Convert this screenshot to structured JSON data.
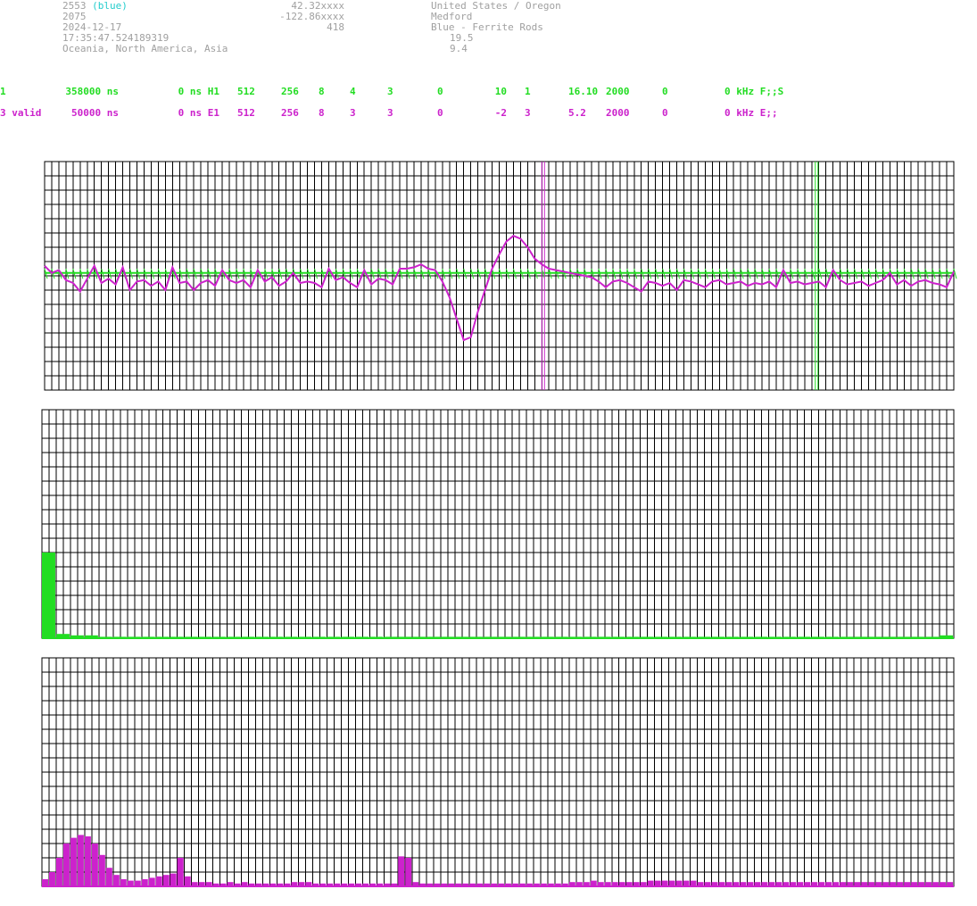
{
  "header": {
    "station_id": "2553",
    "station_color": "(blue)",
    "station_number": "2075",
    "date": "2024-12-17",
    "time": "17:35:47.524189319",
    "regions": "Oceania, North America, Asia",
    "latitude": "42.32xxxx",
    "longitude": "-122.86xxxx",
    "altitude": "418",
    "country": "United States / Oregon",
    "city": "Medford",
    "antenna": "Blue - Ferrite Rods",
    "value_a": "19.5",
    "value_b": "9.4"
  },
  "channels": [
    {
      "c0": "1",
      "c1": "358000 ns",
      "c2": "0 ns H1",
      "c3": "512",
      "c4": "256",
      "c5": "8",
      "c6": "4",
      "c7": "3",
      "c8": "0",
      "c9": "10",
      "c10": "1",
      "c11": "16.10",
      "c12": "2000",
      "c13": "0",
      "c14": "0 kHz F;;S"
    },
    {
      "c0": "3 valid",
      "c1": "50000 ns",
      "c2": "0 ns E1",
      "c3": "512",
      "c4": "256",
      "c5": "8",
      "c6": "3",
      "c7": "3",
      "c8": "0",
      "c9": "-2",
      "c10": "3",
      "c11": "5.2",
      "c12": "2000",
      "c13": "0",
      "c14": "0 kHz E;;"
    }
  ],
  "colors": {
    "green": "#22dd22",
    "magenta": "#cc22cc",
    "gray_text": "#a0a0a0",
    "grid": "#000000"
  },
  "chart_data": [
    {
      "type": "line",
      "panel": "waveform",
      "title": "",
      "xlabel": "",
      "ylabel": "",
      "ylim": [
        -8,
        8
      ],
      "xlim": [
        0,
        256
      ],
      "markers": [
        {
          "x": 140,
          "color": "magenta"
        },
        {
          "x": 217,
          "color": "green"
        }
      ],
      "series": [
        {
          "color": "magenta",
          "x": [
            0,
            2,
            4,
            6,
            8,
            10,
            12,
            14,
            16,
            18,
            20,
            22,
            24,
            26,
            28,
            30,
            32,
            34,
            36,
            38,
            40,
            42,
            44,
            46,
            48,
            50,
            52,
            54,
            56,
            58,
            60,
            62,
            64,
            66,
            68,
            70,
            72,
            74,
            76,
            78,
            80,
            82,
            84,
            86,
            88,
            90,
            92,
            94,
            96,
            98,
            100,
            102,
            104,
            106,
            108,
            110,
            112,
            114,
            116,
            118,
            120,
            122,
            124,
            126,
            128,
            130,
            132,
            134,
            136,
            138,
            140,
            142,
            144,
            146,
            148,
            150,
            152,
            154,
            156,
            158,
            160,
            162,
            164,
            166,
            168,
            170,
            172,
            174,
            176,
            178,
            180,
            182,
            184,
            186,
            188,
            190,
            192,
            194,
            196,
            198,
            200,
            202,
            204,
            206,
            208,
            210,
            212,
            214,
            216,
            218,
            220,
            222,
            224,
            226,
            228,
            230,
            232,
            234,
            236,
            238,
            240,
            242,
            244,
            246,
            248,
            250,
            252,
            254,
            256
          ],
          "values": [
            0.7,
            0.2,
            0.4,
            -0.3,
            -0.5,
            -1.1,
            -0.2,
            0.7,
            -0.5,
            -0.2,
            -0.6,
            0.6,
            -1.0,
            -0.4,
            -0.3,
            -0.7,
            -0.4,
            -1.0,
            0.6,
            -0.5,
            -0.4,
            -1.0,
            -0.5,
            -0.3,
            -0.7,
            0.4,
            -0.3,
            -0.5,
            -0.3,
            -0.8,
            0.4,
            -0.4,
            -0.1,
            -0.7,
            -0.4,
            0.2,
            -0.5,
            -0.4,
            -0.5,
            -0.8,
            0.5,
            -0.3,
            -0.1,
            -0.5,
            -0.8,
            0.4,
            -0.6,
            -0.2,
            -0.3,
            -0.6,
            0.5,
            0.5,
            0.6,
            0.8,
            0.5,
            0.4,
            -0.4,
            -1.5,
            -3.0,
            -4.5,
            -4.3,
            -2.5,
            -1.0,
            0.5,
            1.5,
            2.4,
            2.8,
            2.6,
            2.0,
            1.2,
            0.8,
            0.5,
            0.4,
            0.3,
            0.2,
            0.1,
            0.0,
            -0.1,
            -0.4,
            -0.8,
            -0.4,
            -0.3,
            -0.5,
            -0.8,
            -1.1,
            -0.4,
            -0.5,
            -0.7,
            -0.5,
            -1.0,
            -0.3,
            -0.4,
            -0.6,
            -0.8,
            -0.4,
            -0.3,
            -0.6,
            -0.5,
            -0.4,
            -0.7,
            -0.5,
            -0.6,
            -0.4,
            -0.8,
            0.4,
            -0.5,
            -0.4,
            -0.6,
            -0.5,
            -0.4,
            -0.8,
            0.4,
            -0.3,
            -0.6,
            -0.5,
            -0.4,
            -0.7,
            -0.5,
            -0.3,
            0.2,
            -0.6,
            -0.3,
            -0.7,
            -0.4,
            -0.3,
            -0.5,
            -0.6,
            -0.8,
            0.3
          ]
        }
      ]
    },
    {
      "type": "bar",
      "panel": "green-spectrum",
      "title": "",
      "xlabel": "",
      "ylabel": "",
      "ylim": [
        0,
        16
      ],
      "xlim": [
        0,
        256
      ],
      "series": [
        {
          "color": "green",
          "values": [
            6.0,
            0.3,
            0.2,
            0.2,
            0.1,
            0.1,
            0.1,
            0.1,
            0.1,
            0.1,
            0.1,
            0.1,
            0.1,
            0.1,
            0.1,
            0.1,
            0.1,
            0.1,
            0.1,
            0.1,
            0.1,
            0.1,
            0.1,
            0.1,
            0.1,
            0.1,
            0.1,
            0.1,
            0.1,
            0.1,
            0.1,
            0.1,
            0.1,
            0.1,
            0.1,
            0.1,
            0.1,
            0.1,
            0.1,
            0.1,
            0.1,
            0.1,
            0.1,
            0.1,
            0.1,
            0.1,
            0.1,
            0.1,
            0.1,
            0.1,
            0.1,
            0.1,
            0.1,
            0.1,
            0.1,
            0.1,
            0.1,
            0.1,
            0.1,
            0.1,
            0.1,
            0.1,
            0.1,
            0.2
          ]
        }
      ]
    },
    {
      "type": "bar",
      "panel": "magenta-spectrum",
      "title": "",
      "xlabel": "",
      "ylabel": "",
      "ylim": [
        0,
        16
      ],
      "xlim": [
        0,
        256
      ],
      "series": [
        {
          "color": "magenta",
          "values": [
            0.5,
            1.0,
            2.0,
            3.0,
            3.4,
            3.6,
            3.5,
            3.0,
            2.2,
            1.3,
            0.8,
            0.5,
            0.4,
            0.4,
            0.5,
            0.6,
            0.7,
            0.8,
            0.9,
            2.0,
            0.7,
            0.3,
            0.3,
            0.3,
            0.2,
            0.2,
            0.3,
            0.2,
            0.3,
            0.2,
            0.2,
            0.2,
            0.2,
            0.2,
            0.2,
            0.3,
            0.3,
            0.3,
            0.2,
            0.2,
            0.2,
            0.2,
            0.2,
            0.2,
            0.2,
            0.2,
            0.2,
            0.2,
            0.2,
            0.2,
            2.1,
            2.0,
            0.3,
            0.2,
            0.2,
            0.2,
            0.2,
            0.2,
            0.2,
            0.2,
            0.2,
            0.2,
            0.2,
            0.2,
            0.2,
            0.2,
            0.2,
            0.2,
            0.2,
            0.2,
            0.2,
            0.2,
            0.2,
            0.2,
            0.3,
            0.3,
            0.3,
            0.4,
            0.3,
            0.3,
            0.3,
            0.3,
            0.3,
            0.3,
            0.3,
            0.4,
            0.4,
            0.4,
            0.4,
            0.4,
            0.4,
            0.4,
            0.3,
            0.3,
            0.3,
            0.3,
            0.3,
            0.3,
            0.3,
            0.3,
            0.3,
            0.3,
            0.3,
            0.3,
            0.3,
            0.3,
            0.3,
            0.3,
            0.3,
            0.3,
            0.3,
            0.3,
            0.3,
            0.3,
            0.3,
            0.3,
            0.3,
            0.3,
            0.3,
            0.3,
            0.3,
            0.3,
            0.3,
            0.3,
            0.3,
            0.3,
            0.3,
            0.3
          ]
        }
      ]
    }
  ]
}
